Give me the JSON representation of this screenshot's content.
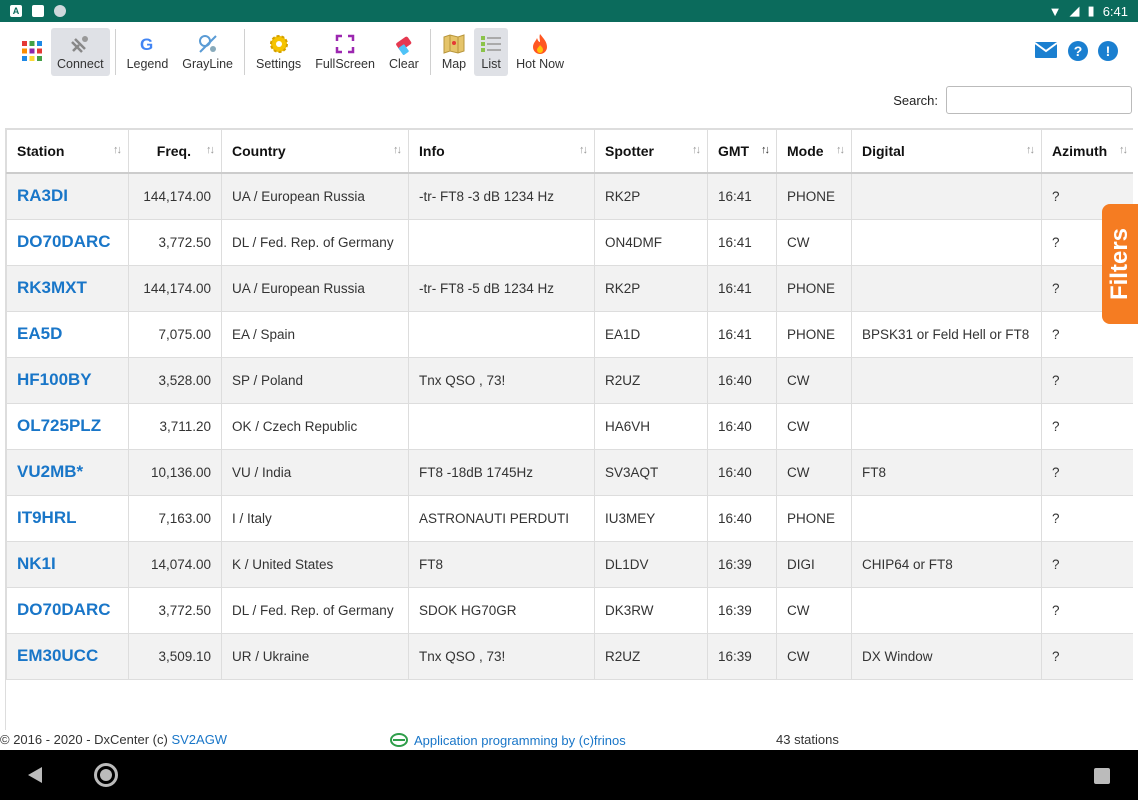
{
  "statusbar": {
    "time": "6:41",
    "colors": {
      "bg": "#0b6b5c"
    }
  },
  "toolbar": {
    "buttons": [
      {
        "label": "Connect",
        "icon": "satellite-dish-icon"
      },
      {
        "label": "Legend",
        "icon": "google-g-icon"
      },
      {
        "label": "GrayLine",
        "icon": "grayline-icon"
      },
      {
        "label": "Settings",
        "icon": "gear-icon"
      },
      {
        "label": "FullScreen",
        "icon": "fullscreen-icon"
      },
      {
        "label": "Clear",
        "icon": "eraser-icon"
      },
      {
        "label": "Map",
        "icon": "map-icon"
      },
      {
        "label": "List",
        "icon": "list-icon"
      },
      {
        "label": "Hot Now",
        "icon": "fire-icon"
      }
    ],
    "right_icons": [
      "mail-icon",
      "help-icon",
      "alert-icon"
    ],
    "help_glyph": "?",
    "alert_glyph": "!"
  },
  "search": {
    "label": "Search:",
    "value": ""
  },
  "table": {
    "columns": [
      "Station",
      "Freq.",
      "Country",
      "Info",
      "Spotter",
      "GMT",
      "Mode",
      "Digital",
      "Azimuth"
    ],
    "rows": [
      {
        "station": "RA3DI",
        "freq": "144,174.00",
        "country": "UA / European Russia",
        "info": "-tr- FT8 -3 dB 1234 Hz",
        "spotter": "RK2P",
        "gmt": "16:41",
        "mode": "PHONE",
        "digital": "",
        "azimuth": "?"
      },
      {
        "station": "DO70DARC",
        "freq": "3,772.50",
        "country": "DL / Fed. Rep. of Germany",
        "info": "",
        "spotter": "ON4DMF",
        "gmt": "16:41",
        "mode": "CW",
        "digital": "",
        "azimuth": "?"
      },
      {
        "station": "RK3MXT",
        "freq": "144,174.00",
        "country": "UA / European Russia",
        "info": "-tr- FT8 -5 dB 1234 Hz",
        "spotter": "RK2P",
        "gmt": "16:41",
        "mode": "PHONE",
        "digital": "",
        "azimuth": "?"
      },
      {
        "station": "EA5D",
        "freq": "7,075.00",
        "country": "EA / Spain",
        "info": "",
        "spotter": "EA1D",
        "gmt": "16:41",
        "mode": "PHONE",
        "digital": "BPSK31 or Feld Hell or FT8",
        "azimuth": "?"
      },
      {
        "station": "HF100BY",
        "freq": "3,528.00",
        "country": "SP / Poland",
        "info": "Tnx QSO , 73!",
        "spotter": "R2UZ",
        "gmt": "16:40",
        "mode": "CW",
        "digital": "",
        "azimuth": "?"
      },
      {
        "station": "OL725PLZ",
        "freq": "3,711.20",
        "country": "OK / Czech Republic",
        "info": "",
        "spotter": "HA6VH",
        "gmt": "16:40",
        "mode": "CW",
        "digital": "",
        "azimuth": "?"
      },
      {
        "station": "VU2MB*",
        "freq": "10,136.00",
        "country": "VU / India",
        "info": "FT8 -18dB 1745Hz",
        "spotter": "SV3AQT",
        "gmt": "16:40",
        "mode": "CW",
        "digital": "FT8",
        "azimuth": "?"
      },
      {
        "station": "IT9HRL",
        "freq": "7,163.00",
        "country": "I / Italy",
        "info": "ASTRONAUTI PERDUTI",
        "spotter": "IU3MEY",
        "gmt": "16:40",
        "mode": "PHONE",
        "digital": "",
        "azimuth": "?"
      },
      {
        "station": "NK1I",
        "freq": "14,074.00",
        "country": "K / United States",
        "info": "FT8",
        "spotter": "DL1DV",
        "gmt": "16:39",
        "mode": "DIGI",
        "digital": "CHIP64 or FT8",
        "azimuth": "?"
      },
      {
        "station": "DO70DARC",
        "freq": "3,772.50",
        "country": "DL / Fed. Rep. of Germany",
        "info": "SDOK HG70GR",
        "spotter": "DK3RW",
        "gmt": "16:39",
        "mode": "CW",
        "digital": "",
        "azimuth": "?"
      },
      {
        "station": "EM30UCC",
        "freq": "3,509.10",
        "country": "UR / Ukraine",
        "info": "Tnx QSO , 73!",
        "spotter": "R2UZ",
        "gmt": "16:39",
        "mode": "CW",
        "digital": "DX Window",
        "azimuth": "?"
      }
    ]
  },
  "filters_tab": "Filters",
  "footer": {
    "copyright": "© 2016 - 2020 - DxCenter (c)",
    "author": "SV2AGW",
    "app": "Application programming by (c)frinos",
    "count": "43 stations"
  },
  "colors": {
    "accent": "#1976c8",
    "filters": "#f57c22"
  }
}
